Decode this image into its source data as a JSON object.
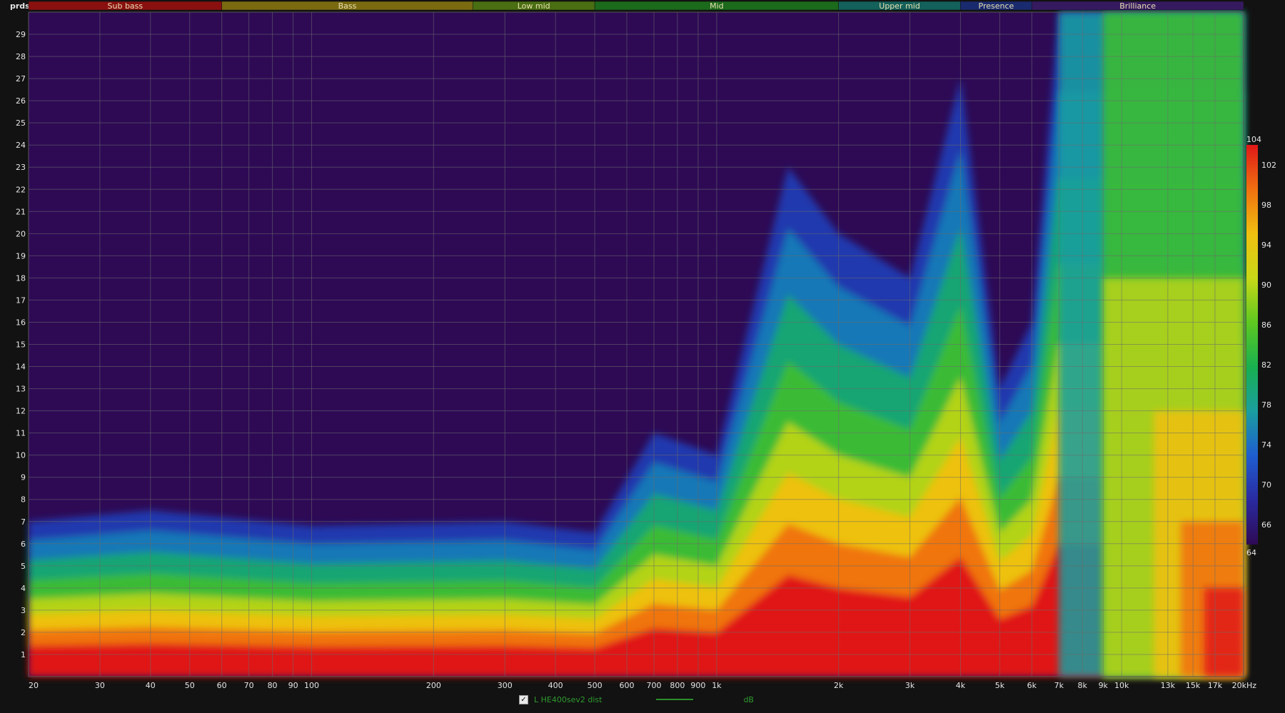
{
  "chart_data": {
    "type": "heatmap",
    "title": "",
    "xlabel": "",
    "x_unit_label": "kHz",
    "ylabel": "prds",
    "x_scale": "log",
    "xlim": [
      20,
      20000
    ],
    "ylim": [
      0,
      30
    ],
    "grid": true,
    "x_ticks": [
      {
        "value": 20,
        "label": "20"
      },
      {
        "value": 30,
        "label": "30"
      },
      {
        "value": 40,
        "label": "40"
      },
      {
        "value": 50,
        "label": "50"
      },
      {
        "value": 60,
        "label": "60"
      },
      {
        "value": 70,
        "label": "70"
      },
      {
        "value": 80,
        "label": "80"
      },
      {
        "value": 90,
        "label": "90"
      },
      {
        "value": 100,
        "label": "100"
      },
      {
        "value": 200,
        "label": "200"
      },
      {
        "value": 300,
        "label": "300"
      },
      {
        "value": 400,
        "label": "400"
      },
      {
        "value": 500,
        "label": "500"
      },
      {
        "value": 600,
        "label": "600"
      },
      {
        "value": 700,
        "label": "700"
      },
      {
        "value": 800,
        "label": "800"
      },
      {
        "value": 900,
        "label": "900"
      },
      {
        "value": 1000,
        "label": "1k"
      },
      {
        "value": 2000,
        "label": "2k"
      },
      {
        "value": 3000,
        "label": "3k"
      },
      {
        "value": 4000,
        "label": "4k"
      },
      {
        "value": 5000,
        "label": "5k"
      },
      {
        "value": 6000,
        "label": "6k"
      },
      {
        "value": 7000,
        "label": "7k"
      },
      {
        "value": 8000,
        "label": "8k"
      },
      {
        "value": 9000,
        "label": "9k"
      },
      {
        "value": 10000,
        "label": "10k"
      },
      {
        "value": 13000,
        "label": "13k"
      },
      {
        "value": 15000,
        "label": "15k"
      },
      {
        "value": 17000,
        "label": "17k"
      },
      {
        "value": 20000,
        "label": "20kHz"
      }
    ],
    "y_ticks": [
      1,
      2,
      3,
      4,
      5,
      6,
      7,
      8,
      9,
      10,
      11,
      12,
      13,
      14,
      15,
      16,
      17,
      18,
      19,
      20,
      21,
      22,
      23,
      24,
      25,
      26,
      27,
      28,
      29
    ],
    "bands": [
      {
        "name": "Sub bass",
        "from": 20,
        "to": 60,
        "color": "#8a1010"
      },
      {
        "name": "Bass",
        "from": 60,
        "to": 250,
        "color": "#7a6a10"
      },
      {
        "name": "Low mid",
        "from": 250,
        "to": 500,
        "color": "#4a6e12"
      },
      {
        "name": "Mid",
        "from": 500,
        "to": 2000,
        "color": "#1c6a1c"
      },
      {
        "name": "Upper mid",
        "from": 2000,
        "to": 4000,
        "color": "#14605a"
      },
      {
        "name": "Presence",
        "from": 4000,
        "to": 6000,
        "color": "#1a2a6e"
      },
      {
        "name": "Brilliance",
        "from": 6000,
        "to": 20000,
        "color": "#351a60"
      }
    ],
    "colorbar": {
      "min": 64,
      "max": 104,
      "labels": [
        102,
        98,
        94,
        90,
        86,
        82,
        78,
        74,
        70,
        66
      ],
      "min_label": "64",
      "max_label": "104",
      "stops": [
        "#2e0a55",
        "#2a2aa0",
        "#1e5ed0",
        "#1a9ea0",
        "#18b050",
        "#5ec820",
        "#c8d818",
        "#f0c010",
        "#f07010",
        "#e01818"
      ]
    },
    "approx_decay_extent": [
      {
        "freq": 20,
        "periods": 7
      },
      {
        "freq": 40,
        "periods": 7.5
      },
      {
        "freq": 100,
        "periods": 6.8
      },
      {
        "freq": 300,
        "periods": 7
      },
      {
        "freq": 500,
        "periods": 6.5
      },
      {
        "freq": 700,
        "periods": 11
      },
      {
        "freq": 1000,
        "periods": 10
      },
      {
        "freq": 1500,
        "periods": 23
      },
      {
        "freq": 2000,
        "periods": 20
      },
      {
        "freq": 3000,
        "periods": 18
      },
      {
        "freq": 4000,
        "periods": 27
      },
      {
        "freq": 5000,
        "periods": 13
      },
      {
        "freq": 6000,
        "periods": 16
      },
      {
        "freq": 7000,
        "periods": 30
      },
      {
        "freq": 20000,
        "periods": 30
      }
    ],
    "series": [
      {
        "name": "L HE400sev2 dist"
      }
    ]
  },
  "legend": {
    "checked": true,
    "series_name": "L HE400sev2 dist",
    "unit": "dB",
    "line_color": "#2a8f2a"
  }
}
